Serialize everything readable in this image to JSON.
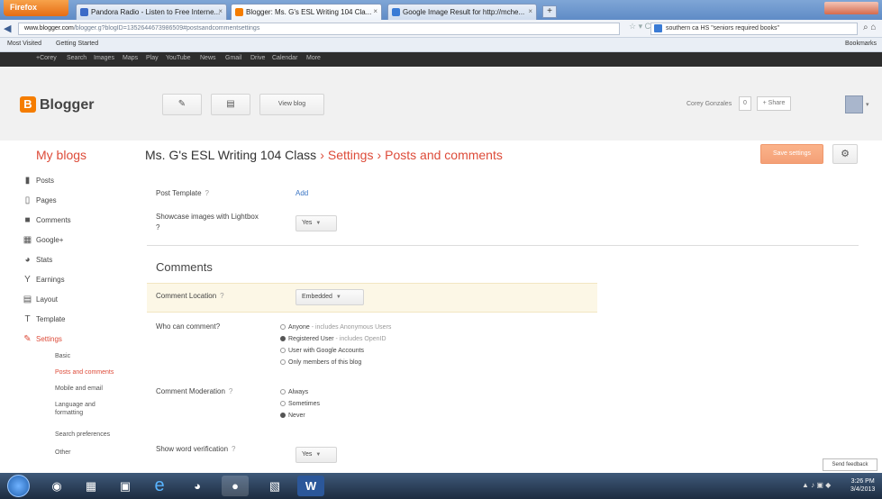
{
  "browser": {
    "menu_label": "Firefox",
    "tabs": [
      {
        "label": "Pandora Radio - Listen to Free Interne...",
        "active": false,
        "color": "#3b6ac7"
      },
      {
        "label": "Blogger: Ms. G's ESL Writing 104 Cla...",
        "active": true,
        "color": "#f57d00"
      },
      {
        "label": "Google Image Result for http://mche...",
        "active": false,
        "color": "#3a7bd5"
      }
    ],
    "new_tab": "+",
    "url_host": "www.blogger.com",
    "url_rest": "/blogger.g?blogID=1352644673986509#postsandcommentsettings",
    "search_text": "southern ca HS \"seniors required books\"",
    "bookmarks": [
      "Most Visited",
      "Getting Started"
    ],
    "bookmarks_right": "Bookmarks"
  },
  "google_bar": [
    "+Corey",
    "Search",
    "Images",
    "Maps",
    "Play",
    "YouTube",
    "News",
    "Gmail",
    "Drive",
    "Calendar",
    "More"
  ],
  "header": {
    "logo": "Blogger",
    "view_blog": "View blog",
    "user": "Corey Gonzales",
    "share_count": "0",
    "share": "+ Share"
  },
  "title_bar": {
    "my_blogs": "My blogs",
    "blog_name": "Ms. G's ESL Writing 104 Class",
    "crumb1": "Settings",
    "crumb2": "Posts and comments",
    "save": "Save settings"
  },
  "sidebar": {
    "items": [
      "Posts",
      "Pages",
      "Comments",
      "Google+",
      "Stats",
      "Earnings",
      "Layout",
      "Template",
      "Settings"
    ],
    "subitems": [
      "Basic",
      "Posts and comments",
      "Mobile and email",
      "Language and",
      "formatting",
      "Search preferences",
      "Other"
    ]
  },
  "settings": {
    "post_template_label": "Post Template",
    "post_template_link": "Add",
    "lightbox_label": "Showcase images with Lightbox",
    "lightbox_value": "Yes",
    "comments_title": "Comments",
    "comment_location_label": "Comment Location",
    "comment_location_value": "Embedded",
    "who_comment_label": "Who can comment?",
    "who_options": [
      {
        "label": "Anyone",
        "note": "- includes Anonymous Users",
        "checked": false
      },
      {
        "label": "Registered User",
        "note": "- includes OpenID",
        "checked": true
      },
      {
        "label": "User with Google Accounts",
        "note": "",
        "checked": false
      },
      {
        "label": "Only members of this blog",
        "note": "",
        "checked": false
      }
    ],
    "moderation_label": "Comment Moderation",
    "moderation_options": [
      {
        "label": "Always",
        "checked": false
      },
      {
        "label": "Sometimes",
        "checked": false
      },
      {
        "label": "Never",
        "checked": true
      }
    ],
    "word_verif_label": "Show word verification",
    "word_verif_value": "Yes",
    "help": "?"
  },
  "feedback": "Send feedback",
  "taskbar": {
    "clock_time": "3:26 PM",
    "clock_date": "3/4/2013"
  },
  "colors": {
    "accent": "#dd4b39",
    "brand": "#f57d00",
    "link": "#3a75c4"
  }
}
